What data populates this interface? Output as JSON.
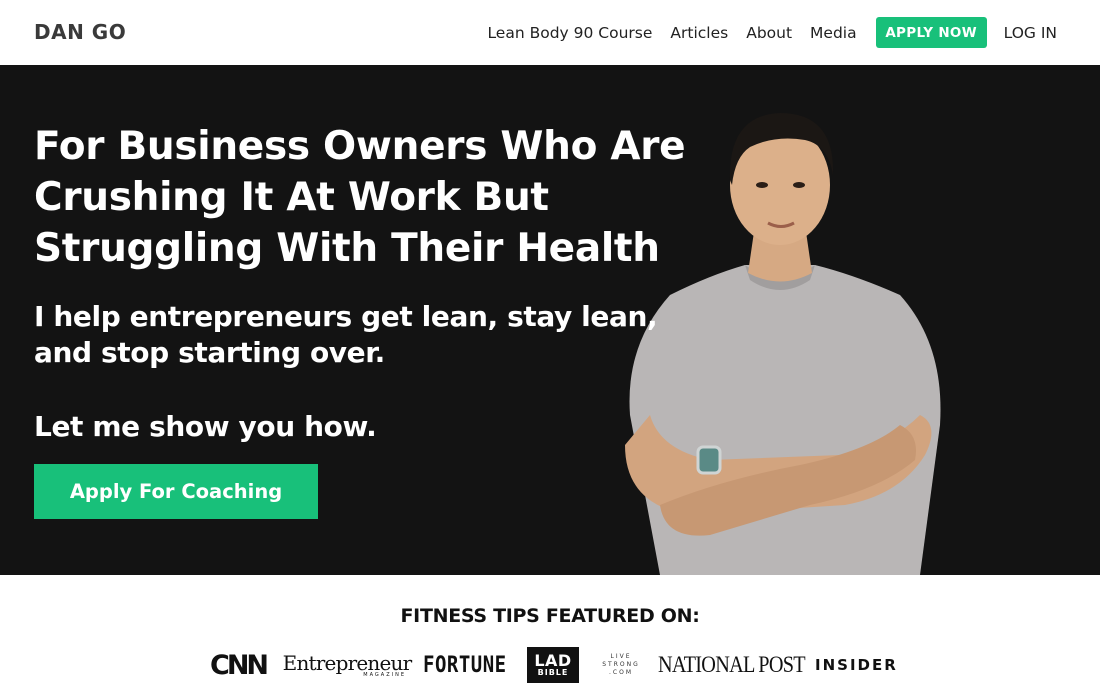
{
  "header": {
    "logo": "DAN GO",
    "nav": [
      "Lean Body 90 Course",
      "Articles",
      "About",
      "Media"
    ],
    "apply_label": "APPLY NOW",
    "login_label": "LOG IN"
  },
  "hero": {
    "title": "For Business Owners Who Are Crushing It At Work But Struggling With Their Health",
    "subtitle": "I help entrepreneurs get lean, stay lean, and stop starting over.",
    "cta_text": "Let me show you how.",
    "button_label": "Apply For Coaching"
  },
  "featured": {
    "title": "FITNESS TIPS FEATURED ON:",
    "logos": {
      "cnn": "CNN",
      "entrepreneur": "Entrepreneur",
      "entrepreneur_sub": "MAGAZINE",
      "fortune": "FORTUNE",
      "lad_top": "LAD",
      "lad_bottom": "BIBLE",
      "livestrong_1": "LIVE",
      "livestrong_2": "STRONG",
      "livestrong_3": ".COM",
      "national_post": "NATIONAL POST",
      "insider": "INSIDER"
    }
  },
  "colors": {
    "accent": "#18c07a",
    "hero_bg": "#131313"
  }
}
